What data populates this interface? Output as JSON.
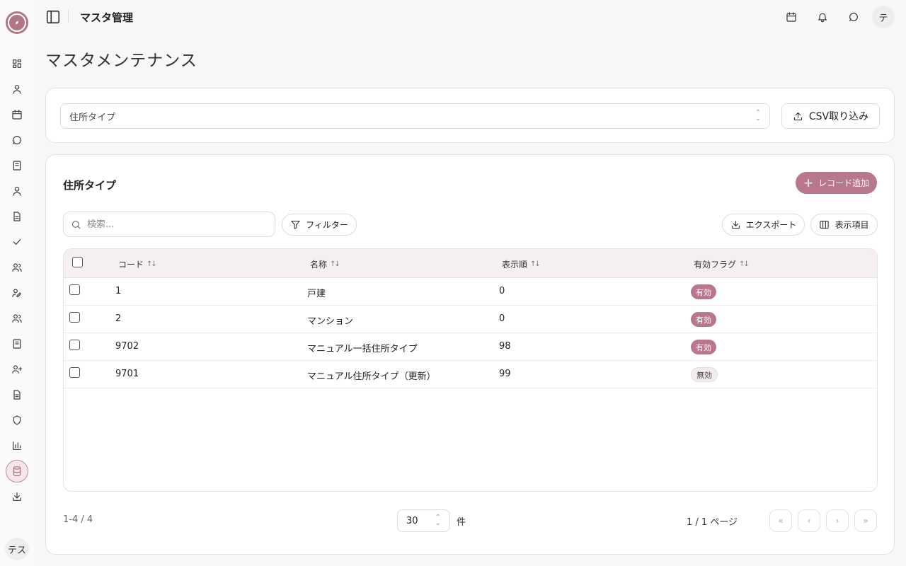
{
  "sidebar": {
    "items": [
      {
        "icon": "dashboard-icon"
      },
      {
        "icon": "user-icon"
      },
      {
        "icon": "calendar-icon"
      },
      {
        "icon": "chat-icon"
      },
      {
        "icon": "book-icon"
      },
      {
        "icon": "person-icon"
      },
      {
        "icon": "document-icon"
      },
      {
        "icon": "check-icon"
      },
      {
        "icon": "users-icon"
      },
      {
        "icon": "user-edit-icon"
      },
      {
        "icon": "group-icon"
      },
      {
        "icon": "notebook-icon"
      },
      {
        "icon": "user-plus-icon"
      },
      {
        "icon": "file-text-icon"
      },
      {
        "icon": "shield-icon"
      },
      {
        "icon": "bar-chart-icon"
      },
      {
        "icon": "database-icon",
        "active": true
      },
      {
        "icon": "download-icon"
      }
    ],
    "user_label": "テス"
  },
  "header": {
    "title": "マスタ管理",
    "avatar": "テ"
  },
  "page": {
    "title": "マスタメンテナンス"
  },
  "master_select": {
    "value": "住所タイプ",
    "csv_button": "CSV取り込み"
  },
  "table_section": {
    "title": "住所タイプ",
    "add_button": "レコード追加",
    "search_placeholder": "検索...",
    "filter_button": "フィルター",
    "export_button": "エクスポート",
    "columns_button": "表示項目",
    "columns": [
      "コード",
      "名称",
      "表示順",
      "有効フラグ"
    ],
    "rows": [
      {
        "code": "1",
        "name": "戸建",
        "order": "0",
        "flag": "有効",
        "active": true
      },
      {
        "code": "2",
        "name": "マンション",
        "order": "0",
        "flag": "有効",
        "active": true
      },
      {
        "code": "9702",
        "name": "マニュアル一括住所タイプ",
        "order": "98",
        "flag": "有効",
        "active": true
      },
      {
        "code": "9701",
        "name": "マニュアル住所タイプ（更新）",
        "order": "99",
        "flag": "無効",
        "active": false
      }
    ]
  },
  "pagination": {
    "range": "1-4 / 4",
    "per_page": "30",
    "per_page_unit": "件",
    "page_info": "1 / 1 ページ"
  },
  "colors": {
    "accent": "#b8778a"
  }
}
